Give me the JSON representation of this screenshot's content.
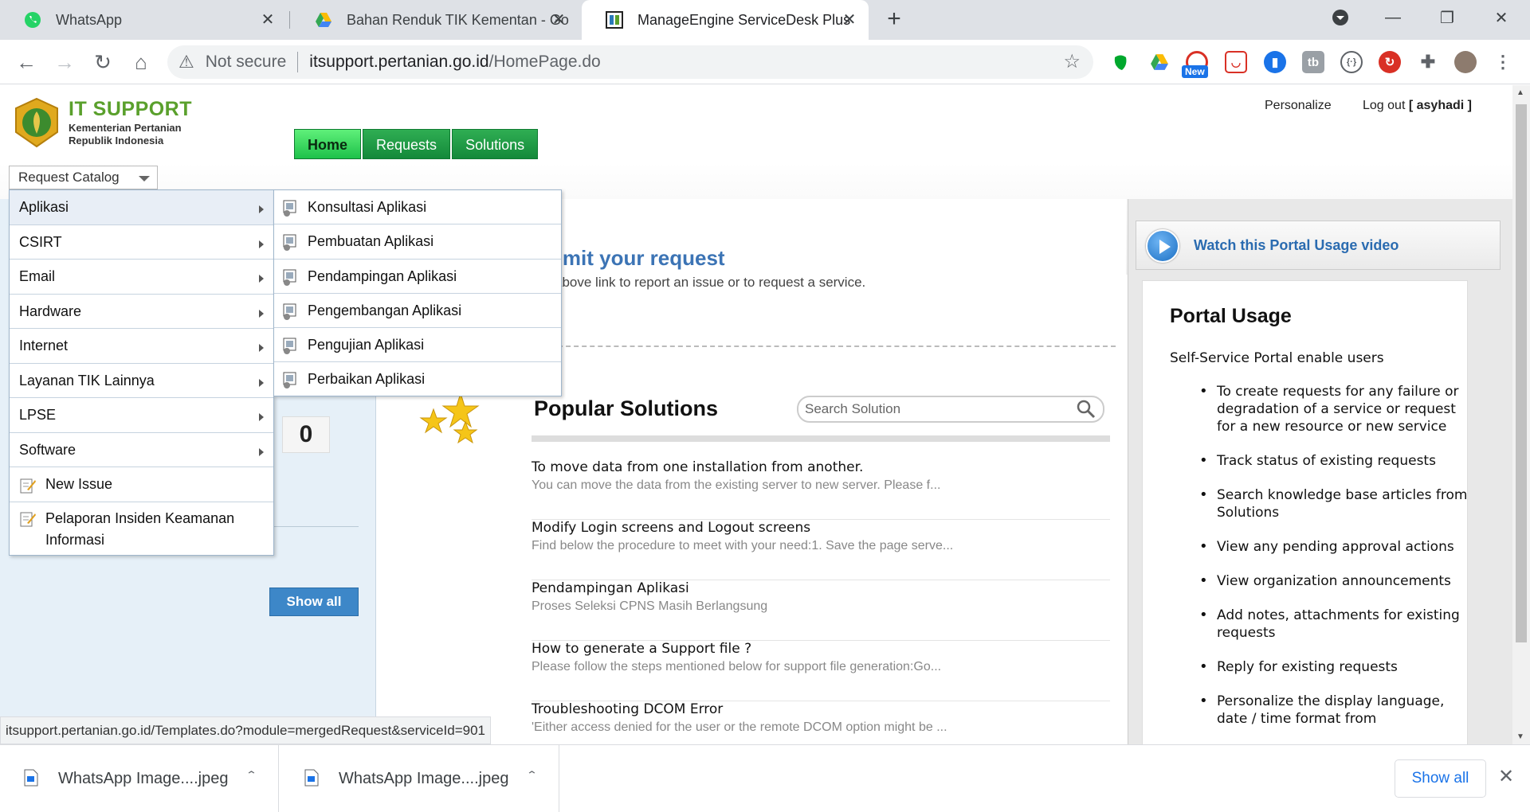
{
  "browser": {
    "tabs": [
      {
        "title": "WhatsApp",
        "icon": "whatsapp-icon"
      },
      {
        "title": "Bahan Renduk TIK Kementan - Go",
        "icon": "google-drive-icon"
      },
      {
        "title": "ManageEngine ServiceDesk Plus",
        "icon": "manageengine-icon",
        "active": true
      }
    ],
    "address": {
      "security_label": "Not secure",
      "host": "itsupport.pertanian.go.id",
      "path": "/HomePage.do"
    },
    "extensions": [
      "evernote-icon",
      "google-drive-icon",
      "new-extension-icon",
      "pocket-icon",
      "bookmark-icon",
      "tb-icon",
      "code-icon",
      "refresh-red-icon",
      "puzzle-icon",
      "profile-avatar",
      "menu-dots-icon"
    ],
    "ext_new_badge": "New",
    "ext_tb_label": "tb"
  },
  "site": {
    "logo_title": "IT SUPPORT",
    "logo_sub1": "Kementerian Pertanian",
    "logo_sub2": "Republik Indonesia",
    "personalize": "Personalize",
    "logout": "Log out",
    "user": "[ asyhadi ]",
    "nav": [
      "Home",
      "Requests",
      "Solutions"
    ],
    "request_catalog": "Request Catalog"
  },
  "catalog_menu": {
    "items": [
      {
        "label": "Aplikasi",
        "submenu": true
      },
      {
        "label": "CSIRT",
        "submenu": true
      },
      {
        "label": "Email",
        "submenu": true
      },
      {
        "label": "Hardware",
        "submenu": true
      },
      {
        "label": "Internet",
        "submenu": true
      },
      {
        "label": "Layanan TIK Lainnya",
        "submenu": true
      },
      {
        "label": "LPSE",
        "submenu": true
      },
      {
        "label": "Software",
        "submenu": true
      },
      {
        "label": "New Issue",
        "icon": "new-issue-icon"
      },
      {
        "label": "Pelaporan Insiden Keamanan Informasi",
        "icon": "new-issue-icon"
      }
    ],
    "aplikasi_submenu": [
      "Konsultasi Aplikasi",
      "Pembuatan Aplikasi",
      "Pendampingan Aplikasi",
      "Pengembangan Aplikasi",
      "Pengujian Aplikasi",
      "Perbaikan Aplikasi"
    ]
  },
  "left": {
    "counter": "0",
    "show_all": "Show all"
  },
  "center": {
    "submit_title": "omit your request",
    "submit_sub": "above link to report an issue or to request a service.",
    "popular_title": "Popular Solutions",
    "search_placeholder": "Search Solution",
    "solutions": [
      {
        "title": "To move data from one installation from another.",
        "desc": "You can move the data from the existing server to new server. Please f..."
      },
      {
        "title": "Modify Login screens and Logout screens",
        "desc": "Find below the procedure to meet with your need:1. Save the page serve..."
      },
      {
        "title": "Pendampingan Aplikasi",
        "desc": "Proses Seleksi CPNS Masih Berlangsung"
      },
      {
        "title": "How to generate a Support file ?",
        "desc": "Please follow the steps mentioned below for support file generation:Go..."
      },
      {
        "title": "Troubleshooting DCOM Error",
        "desc": "'Either access denied for the user or the remote DCOM option might be ..."
      }
    ]
  },
  "right": {
    "video_label": "Watch this Portal Usage video",
    "portal_title": "Portal Usage",
    "portal_intro": "Self-Service Portal enable users",
    "portal_items": [
      "To create requests for any failure or degradation of a service or request for a new resource or new service",
      "Track status of existing requests",
      "Search knowledge base articles from Solutions",
      "View any pending approval actions",
      "View organization announcements",
      "Add notes, attachments for existing requests",
      "Reply for existing requests",
      "Personalize the display language, date / time format from"
    ]
  },
  "status_url": "itsupport.pertanian.go.id/Templates.do?module=mergedRequest&serviceId=901",
  "downloads": {
    "items": [
      "WhatsApp Image....jpeg",
      "WhatsApp Image....jpeg"
    ],
    "show_all": "Show all"
  }
}
